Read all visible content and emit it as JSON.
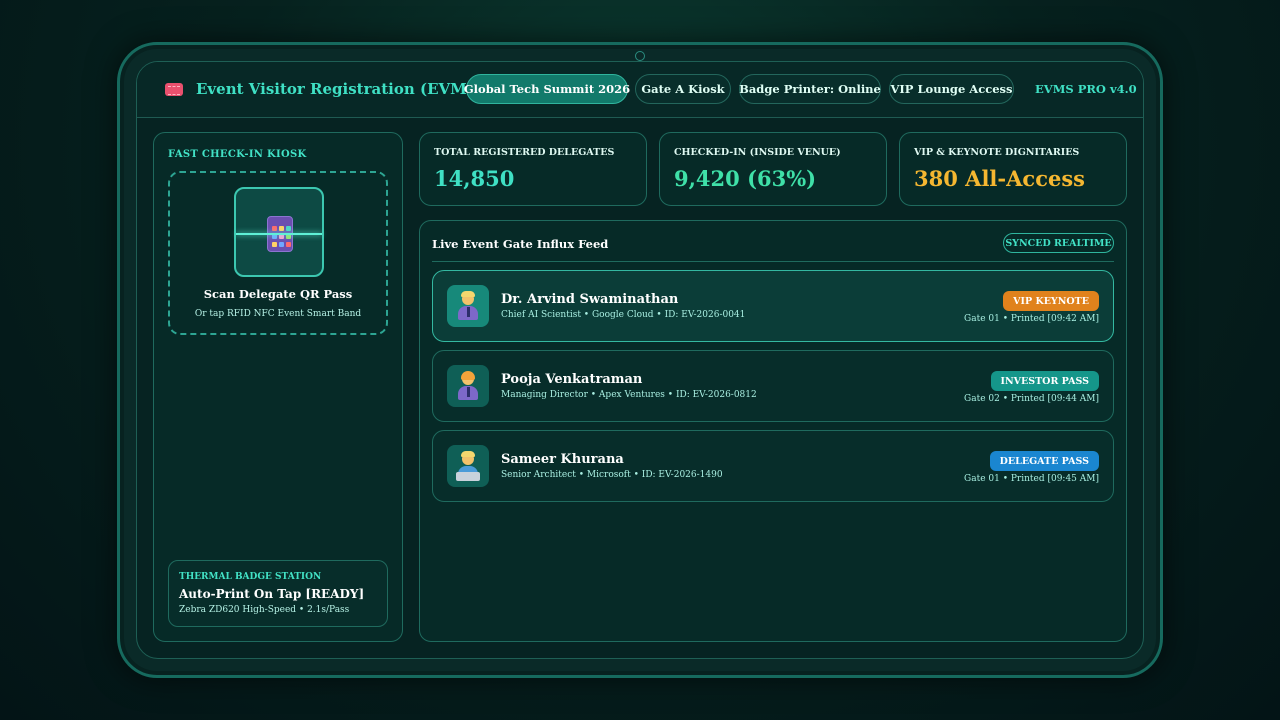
{
  "header": {
    "title": "Event Visitor Registration (EVMS)",
    "tabs": [
      {
        "label": "Global Tech Summit 2026",
        "active": true
      },
      {
        "label": "Gate A Kiosk",
        "active": false
      },
      {
        "label": "Badge Printer: Online",
        "active": false
      },
      {
        "label": "VIP Lounge Access",
        "active": false
      }
    ],
    "version": "EVMS PRO v4.0"
  },
  "kiosk": {
    "title": "FAST CHECK-IN KIOSK",
    "scan_title": "Scan Delegate QR Pass",
    "scan_sub": "Or tap RFID NFC Event Smart Band",
    "printer": {
      "label": "THERMAL BADGE STATION",
      "title": "Auto-Print On Tap [READY]",
      "sub": "Zebra ZD620 High-Speed • 2.1s/Pass"
    }
  },
  "stats": [
    {
      "label": "TOTAL REGISTERED DELEGATES",
      "value": "14,850",
      "color": "#3fe0c4"
    },
    {
      "label": "CHECKED-IN (INSIDE VENUE)",
      "value": "9,420 (63%)",
      "color": "#3fe0a8"
    },
    {
      "label": "VIP & KEYNOTE DIGNITARIES",
      "value": "380 All-Access",
      "color": "#f5b731"
    }
  ],
  "feed": {
    "title": "Live Event Gate Influx Feed",
    "sync_label": "SYNCED REALTIME",
    "entries": [
      {
        "name": "Dr. Arvind Swaminathan",
        "meta": "Chief AI Scientist • Google Cloud • ID: EV-2026-0041",
        "badge": "VIP KEYNOTE",
        "badge_color": "#e0821c",
        "gate": "Gate 01 • Printed [09:42 AM]",
        "avatar_icon": "businessman-icon"
      },
      {
        "name": "Pooja Venkatraman",
        "meta": "Managing Director • Apex Ventures • ID: EV-2026-0812",
        "badge": "INVESTOR PASS",
        "badge_color": "#15968a",
        "gate": "Gate 02 • Printed [09:44 AM]",
        "avatar_icon": "businesswoman-icon"
      },
      {
        "name": "Sameer Khurana",
        "meta": "Senior Architect • Microsoft • ID: EV-2026-1490",
        "badge": "DELEGATE PASS",
        "badge_color": "#1a86d0",
        "gate": "Gate 01 • Printed [09:45 AM]",
        "avatar_icon": "technologist-icon"
      }
    ]
  }
}
